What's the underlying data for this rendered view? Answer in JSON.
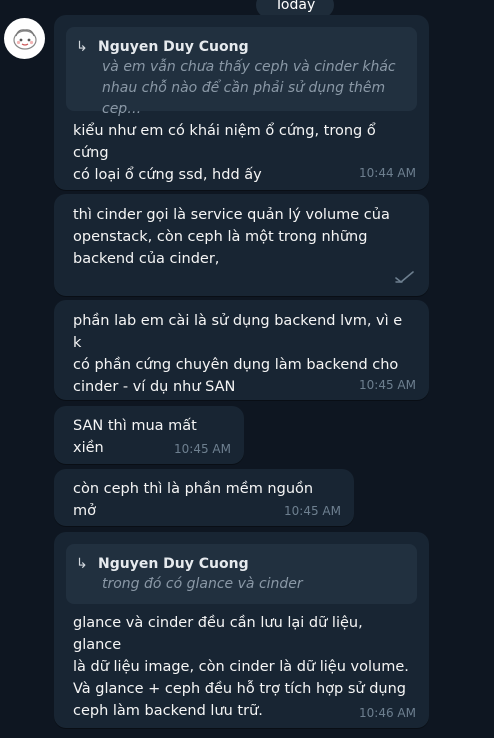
{
  "date_separator": "Today",
  "messages": [
    {
      "reply_author": "Nguyen Duy Cuong",
      "reply_quote": "và em vẫn chưa thấy ceph và cinder khác\nnhau chỗ nào để cần phải sử dụng thêm cep…",
      "text": "kiểu như em có khái niệm ổ cứng, trong ổ cứng\ncó loại ổ cứng ssd, hdd ấy",
      "time": "10:44 AM"
    },
    {
      "text": "thì cinder gọi là service quản lý volume của\nopenstack, còn ceph là một trong những\nbackend của cinder,"
    },
    {
      "text": "phần lab em cài là sử dụng backend lvm, vì e k\ncó phần cứng chuyên dụng làm backend cho\ncinder - ví dụ như SAN",
      "time": "10:45 AM"
    },
    {
      "text": "SAN thì mua mất xiền",
      "time": "10:45 AM"
    },
    {
      "text": "còn ceph thì là phần mềm nguồn mở",
      "time": "10:45 AM"
    },
    {
      "reply_author": "Nguyen Duy Cuong",
      "reply_quote": "trong đó có glance và cinder",
      "text": "glance và cinder đều cần lưu lại dữ liệu, glance\nlà dữ liệu image, còn cinder là dữ liệu volume.\nVà glance + ceph đều hỗ trợ tích hợp sử dụng\nceph làm backend lưu trữ.",
      "time": "10:46 AM"
    }
  ],
  "icons": {
    "avatar": "cartoon-face-avatar",
    "reply": "reply-arrow-icon",
    "unread": "unread-check-icon"
  },
  "colors": {
    "background": "#0e1621",
    "bubble": "#182533",
    "reply_box": "#21303f",
    "time": "#6d7f8f"
  }
}
